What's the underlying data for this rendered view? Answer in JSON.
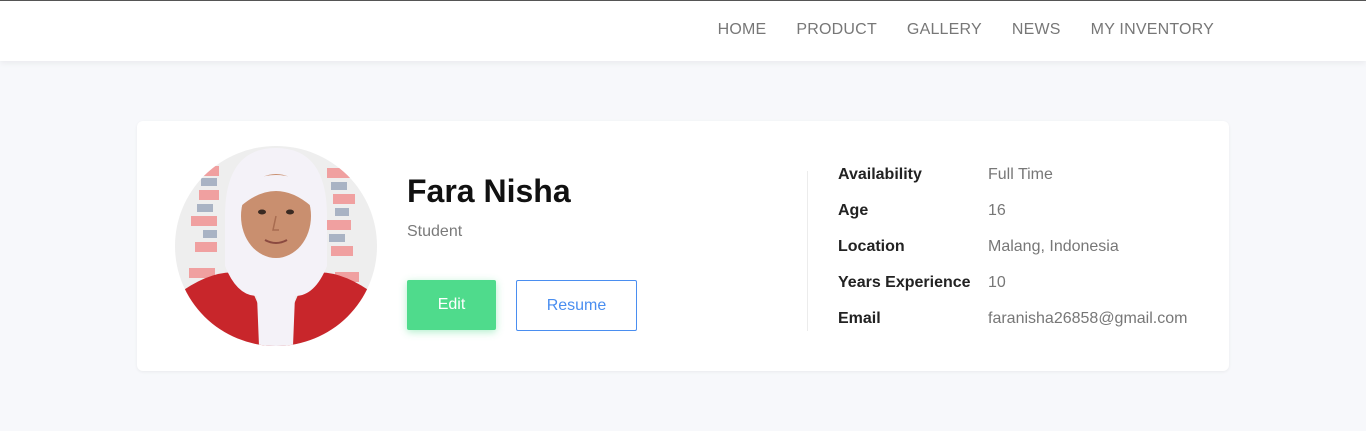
{
  "nav": {
    "items": [
      "HOME",
      "PRODUCT",
      "GALLERY",
      "NEWS",
      "MY INVENTORY"
    ]
  },
  "profile": {
    "name": "Fara Nisha",
    "role": "Student",
    "edit_label": "Edit",
    "resume_label": "Resume",
    "details": [
      {
        "label": "Availability",
        "value": "Full Time"
      },
      {
        "label": "Age",
        "value": "16"
      },
      {
        "label": "Location",
        "value": "Malang, Indonesia"
      },
      {
        "label": "Years Experience",
        "value": "10"
      },
      {
        "label": "Email",
        "value": "faranisha26858@gmail.com"
      }
    ]
  },
  "colors": {
    "accent_green": "#4fdb8c",
    "accent_blue": "#4a8ef0",
    "background": "#f7f8fb"
  }
}
